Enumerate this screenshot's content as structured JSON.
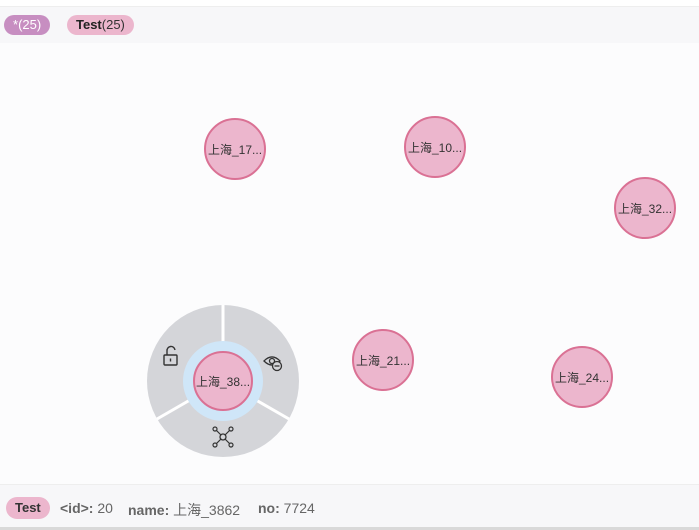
{
  "legend": {
    "all": {
      "name": "*",
      "count": "(25)"
    },
    "test": {
      "name": "Test",
      "count": "(25)"
    }
  },
  "nodes": [
    {
      "id": "node-1",
      "label": "上海_17..."
    },
    {
      "id": "node-2",
      "label": "上海_10..."
    },
    {
      "id": "node-3",
      "label": "上海_32..."
    },
    {
      "id": "node-4",
      "label": "上海_21..."
    },
    {
      "id": "node-5",
      "label": "上海_24..."
    },
    {
      "id": "node-selected",
      "label": "上海_38..."
    }
  ],
  "ring_menu": {
    "icons": [
      "unlock-icon",
      "hide-eye-icon",
      "expand-graph-icon"
    ]
  },
  "details": {
    "label": "Test",
    "id_key": "<id>:",
    "id_value": "20",
    "name_key": "name:",
    "name_value": "上海_3862",
    "no_key": "no:",
    "no_value": "7724"
  },
  "colors": {
    "node_fill": "#ecb6cd",
    "node_border": "#da7194",
    "all_pill": "#c78ec1",
    "ring": "#d4d5d9",
    "halo": "#cfe6f8"
  }
}
